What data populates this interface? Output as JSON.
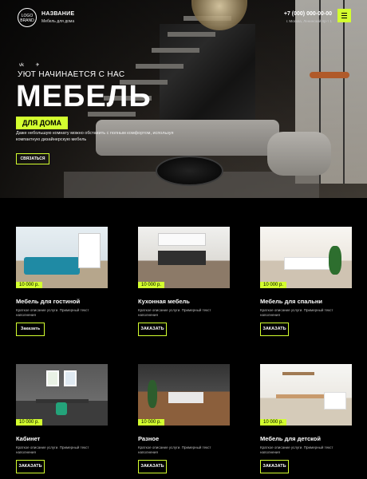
{
  "accent_color": "#d3ff2f",
  "header": {
    "logo_text": "LOGO BRAND",
    "brand_title": "НАЗВАНИЕ",
    "brand_subtitle": "Мебель для дома",
    "phone": "+7 (000) 000-00-00",
    "address": "г. Москва, Ленинский пр-т 1",
    "menu_icon": "hamburger-icon"
  },
  "socials": {
    "vk_label": "vk",
    "telegram_label": "✈"
  },
  "hero": {
    "eyebrow": "УЮТ НАЧИНАЕТСЯ С НАС",
    "title": "МЕБЕЛЬ",
    "badge": "ДЛЯ ДОМА",
    "description": "Даже небольшую комнату можно обставить с полным комфортом, используя компактную дизайнерскую мебель",
    "button_label": "СВЯЗАТЬСЯ"
  },
  "products": [
    {
      "name": "Мебель для гостиной",
      "price": "10 000 р.",
      "description": "Краткое описание услуги. Примерный текст наполнения",
      "button_label": "Заказать"
    },
    {
      "name": "Кухонная мебель",
      "price": "10 000 р.",
      "description": "Краткое описание услуги. Примерный текст наполнения",
      "button_label": "ЗАКАЗАТЬ"
    },
    {
      "name": "Мебель для спальни",
      "price": "10 000 р.",
      "description": "Краткое описание услуги. Примерный текст наполнения",
      "button_label": "ЗАКАЗАТЬ"
    },
    {
      "name": "Кабинет",
      "price": "10 000 р.",
      "description": "Краткое описание услуги. Примерный текст наполнения",
      "button_label": "ЗАКАЗАТЬ"
    },
    {
      "name": "Разное",
      "price": "10 000 р.",
      "description": "Краткое описание услуги. Примерный текст наполнения",
      "button_label": "ЗАКАЗАТЬ"
    },
    {
      "name": "Мебель для детской",
      "price": "10 000 р.",
      "description": "Краткое описание услуги. Примерный текст наполнения",
      "button_label": "ЗАКАЗАТЬ"
    }
  ]
}
